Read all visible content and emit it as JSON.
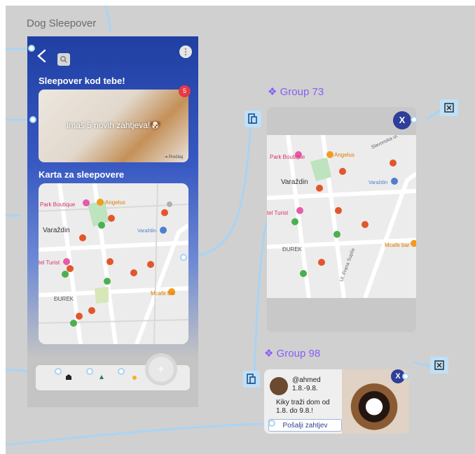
{
  "frame": {
    "title": "Dog Sleepover"
  },
  "home": {
    "sleepover_title": "Sleepover kod tebe!",
    "hero_text": "Imaš 5 novih zahtjeva!🐶",
    "hero_small": "⇥ Pročitaj",
    "badge_count": "5",
    "map_title": "Karta za sleepovere"
  },
  "map": {
    "labels": [
      "Park Boutique",
      "Angelus",
      "Varaždin",
      "Varaždin",
      "tel Turist",
      "ĐUREK",
      "Mcafe bar",
      "Ul. Frana Supila",
      "Slavonska ul."
    ]
  },
  "group73": {
    "label": "Group 73",
    "close_label": "X"
  },
  "group98": {
    "label": "Group 98",
    "close_label": "X",
    "username": "@ahmed",
    "dates": "1.8.-9.8.",
    "message": "Kiky traži dom od 1.8. do 9.8.!",
    "button_label": "Pošalji zahtjev"
  },
  "colors": {
    "brand": "#2e3e99",
    "component": "#8b5cf6",
    "connector": "#a8d4f5",
    "badge": "#e63946"
  }
}
